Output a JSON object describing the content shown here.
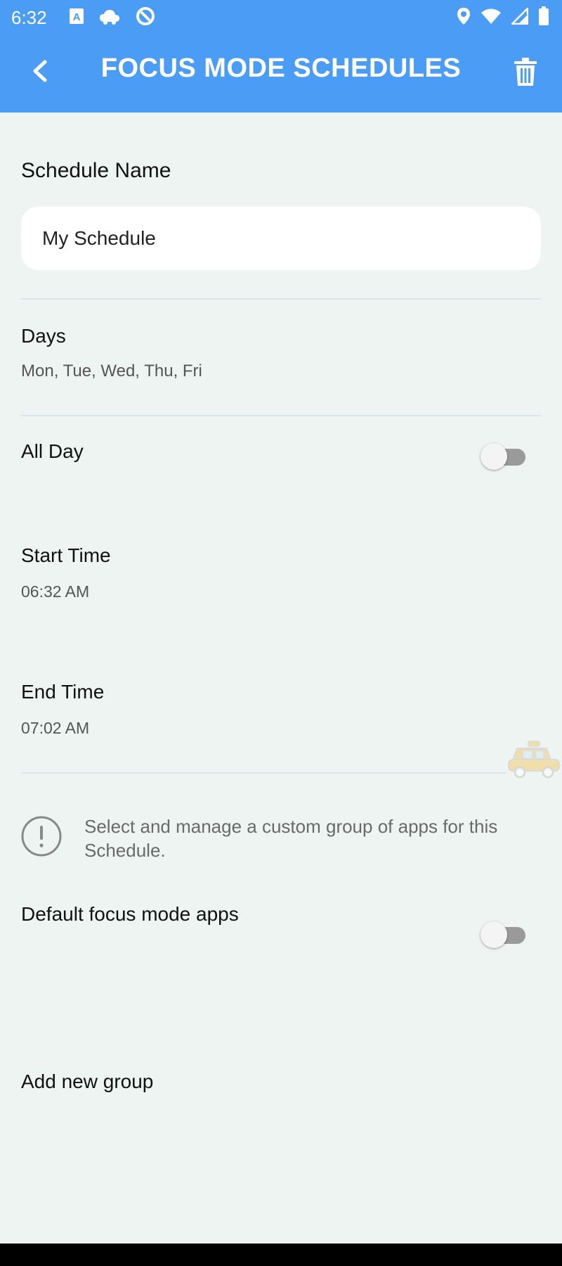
{
  "status_bar": {
    "time": "6:32",
    "left_icons": [
      "text-a-icon",
      "cloud-icon",
      "sync-icon"
    ],
    "right_icons": [
      "location-icon",
      "wifi-icon",
      "signal-icon",
      "battery-icon"
    ]
  },
  "header": {
    "title": "FOCUS MODE SCHEDULES",
    "back_icon": "chevron-left-icon",
    "delete_icon": "trash-icon",
    "color": "#4a9cf5"
  },
  "schedule_name": {
    "label": "Schedule Name",
    "value": "My Schedule"
  },
  "days": {
    "label": "Days",
    "value": "Mon, Tue, Wed, Thu, Fri"
  },
  "all_day": {
    "label": "All Day",
    "enabled": false
  },
  "start_time": {
    "label": "Start Time",
    "value": "06:32 AM"
  },
  "end_time": {
    "label": "End Time",
    "value": "07:02 AM"
  },
  "info": {
    "icon": "info-icon",
    "text": "Select and manage a custom group of apps for this Schedule."
  },
  "default_apps": {
    "label": "Default focus mode apps",
    "enabled": false
  },
  "add_group": {
    "label": "Add new group"
  }
}
